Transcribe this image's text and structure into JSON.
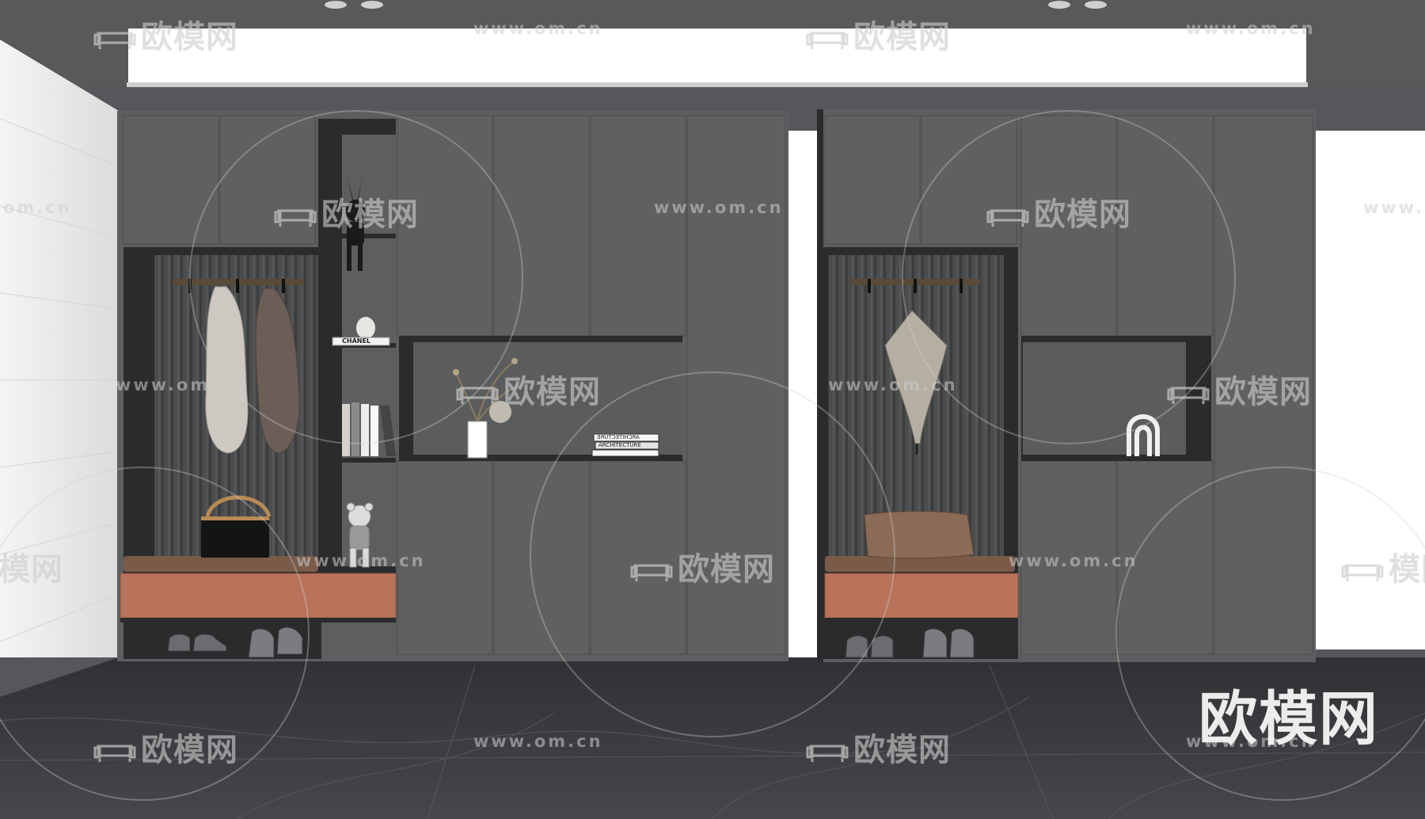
{
  "scene": {
    "colors": {
      "ceiling": "#58595b",
      "soffit": "#ffffff",
      "cabinet": "#5c5e60",
      "cabinet_dark": "#2a2b2d",
      "slat_panel": "#4e5052",
      "bench_drawer": "#b9735a",
      "cushion": "#7a5a48",
      "floor": "#3c3e41",
      "left_wall": "#ececec"
    },
    "icons": [
      "sofa-icon",
      "rabbit-figurine",
      "bear-figurine",
      "vase",
      "arch-sculpture",
      "coat",
      "umbrella",
      "handbag",
      "sneakers"
    ]
  },
  "products": {
    "box_label": "CHANEL",
    "book_title": "ARCHITECTURE",
    "book_title_mirrored": "ARCHITECTURE"
  },
  "watermarks": {
    "brand": "欧模网",
    "brand_cropped": "模网",
    "url": "www.om.cn",
    "url_cropped_left": "om.cn",
    "url_cropped_right": "www.",
    "url_partial": "www.om",
    "corner_logo": "欧模网"
  }
}
